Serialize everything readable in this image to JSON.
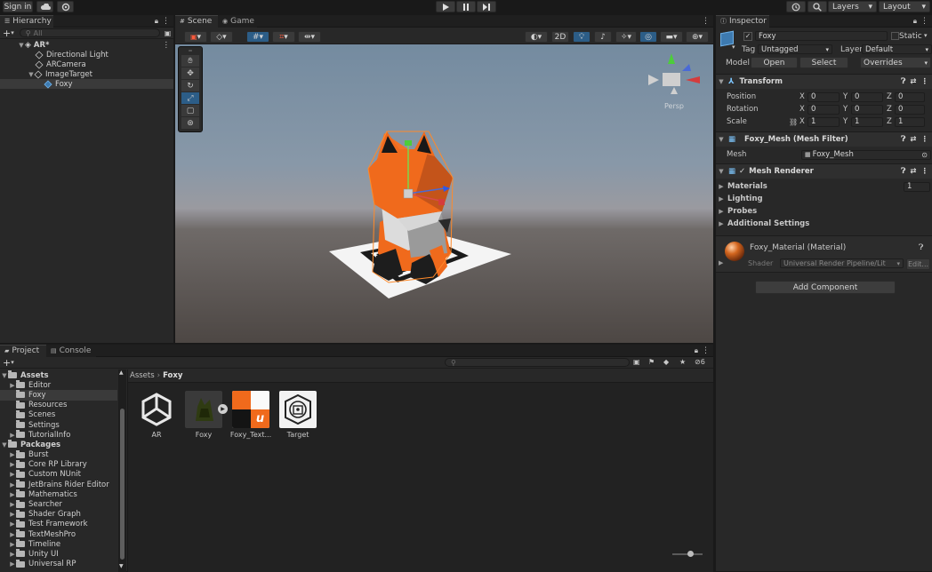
{
  "toolbar": {
    "sign_in": "Sign in",
    "layers": "Layers",
    "layout": "Layout"
  },
  "hierarchy": {
    "tab": "Hierarchy",
    "search_placeholder": "All",
    "root": "AR*",
    "items": [
      {
        "label": "Directional Light"
      },
      {
        "label": "ARCamera"
      },
      {
        "label": "ImageTarget"
      },
      {
        "label": "Foxy"
      }
    ]
  },
  "scene": {
    "tabs": [
      "Scene",
      "Game"
    ],
    "mode_2d": "2D",
    "gizmo_label": "Persp"
  },
  "inspector": {
    "tab": "Inspector",
    "object_name": "Foxy",
    "static_label": "Static",
    "tag_label": "Tag",
    "tag_value": "Untagged",
    "layer_label": "Layer",
    "layer_value": "Default",
    "model_label": "Model",
    "open_btn": "Open",
    "select_btn": "Select",
    "overrides": "Overrides",
    "transform": {
      "title": "Transform",
      "position_label": "Position",
      "rotation_label": "Rotation",
      "scale_label": "Scale",
      "position": [
        "0",
        "0",
        "0"
      ],
      "rotation": [
        "0",
        "0",
        "0"
      ],
      "scale": [
        "1",
        "1",
        "1"
      ]
    },
    "mesh_filter": {
      "title": "Foxy_Mesh (Mesh Filter)",
      "mesh_label": "Mesh",
      "mesh_value": "Foxy_Mesh"
    },
    "mesh_renderer": {
      "title": "Mesh Renderer",
      "materials": "Materials",
      "materials_count": "1",
      "lighting": "Lighting",
      "probes": "Probes",
      "additional": "Additional Settings"
    },
    "material": {
      "name": "Foxy_Material (Material)",
      "shader_label": "Shader",
      "shader_value": "Universal Render Pipeline/Lit",
      "edit_btn": "Edit..."
    },
    "add_component": "Add Component"
  },
  "project": {
    "tabs": [
      "Project",
      "Console"
    ],
    "hidden_count": "6",
    "breadcrumb": [
      "Assets",
      "Foxy"
    ],
    "tree": [
      {
        "label": "Assets",
        "level": 0,
        "open": true,
        "bold": true
      },
      {
        "label": "Editor",
        "level": 1
      },
      {
        "label": "Foxy",
        "level": 1,
        "selected": true
      },
      {
        "label": "Resources",
        "level": 1
      },
      {
        "label": "Scenes",
        "level": 1
      },
      {
        "label": "Settings",
        "level": 1
      },
      {
        "label": "TutorialInfo",
        "level": 1
      },
      {
        "label": "Packages",
        "level": 0,
        "open": true,
        "bold": true
      },
      {
        "label": "Burst",
        "level": 1
      },
      {
        "label": "Core RP Library",
        "level": 1
      },
      {
        "label": "Custom NUnit",
        "level": 1
      },
      {
        "label": "JetBrains Rider Editor",
        "level": 1
      },
      {
        "label": "Mathematics",
        "level": 1
      },
      {
        "label": "Searcher",
        "level": 1
      },
      {
        "label": "Shader Graph",
        "level": 1
      },
      {
        "label": "Test Framework",
        "level": 1
      },
      {
        "label": "TextMeshPro",
        "level": 1
      },
      {
        "label": "Timeline",
        "level": 1
      },
      {
        "label": "Unity UI",
        "level": 1
      },
      {
        "label": "Universal RP",
        "level": 1
      }
    ],
    "assets": [
      {
        "label": "AR",
        "icon": "unity-logo-icon"
      },
      {
        "label": "Foxy",
        "icon": "model-prefab-icon"
      },
      {
        "label": "Foxy_Text...",
        "icon": "texture-icon"
      },
      {
        "label": "Target",
        "icon": "image-target-icon"
      }
    ]
  },
  "colors": {
    "accent_blue": "#2c5d87",
    "fox_orange": "#f06a1c",
    "panel": "#282828"
  }
}
